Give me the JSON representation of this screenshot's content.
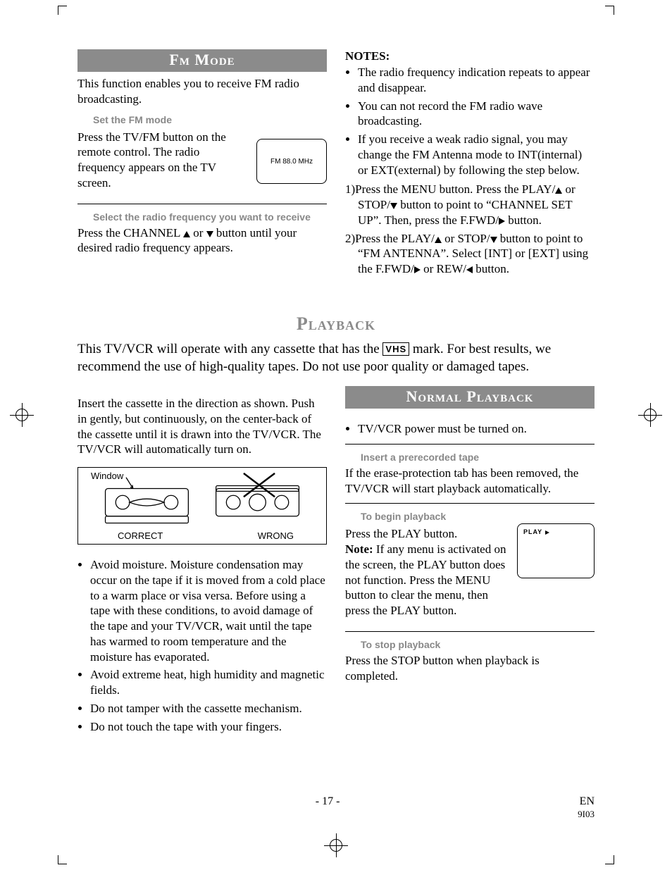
{
  "fm": {
    "heading": "Fm Mode",
    "intro": "This function enables you to receive FM radio broadcasting.",
    "step1_title": "Set the FM mode",
    "step1_text": "Press the TV/FM button on the remote control. The radio frequency appears on the TV screen.",
    "screen_text": "FM 88.0 MHz",
    "step2_title": "Select the radio frequency you want to receive",
    "step2_text_a": "Press the CHANNEL ",
    "step2_text_b": " or ",
    "step2_text_c": " button until your desired radio frequency appears."
  },
  "notes": {
    "heading": "NOTES:",
    "items": [
      "The radio frequency indication repeats to appear and disappear.",
      "You can not record the FM radio wave broadcasting.",
      "If you receive a weak radio signal, you may change the FM Antenna mode to INT(internal) or EXT(external) by following the step below."
    ],
    "n1_a": "1)Press the MENU button. Press the PLAY/",
    "n1_b": " or STOP/",
    "n1_c": " button to point to “CHANNEL SET UP”. Then, press the F.FWD/",
    "n1_d": " button.",
    "n2_a": "2)Press the PLAY/",
    "n2_b": " or STOP/",
    "n2_c": " button to point to “FM ANTENNA”. Select [INT] or [EXT] using the F.FWD/",
    "n2_d": " or REW/",
    "n2_e": " button."
  },
  "playback": {
    "heading": "Playback",
    "intro_a": "This TV/VCR will operate with any cassette that has the ",
    "intro_b": " mark. For best results, we recommend the use of high-quality tapes. Do not use poor quality or damaged tapes.",
    "vhs_mark": "VHS",
    "insert_text": "Insert the cassette in the direction as shown. Push in gently, but continuously, on the center-back of the cassette until it is drawn into the TV/VCR. The TV/VCR will automatically turn on.",
    "fig_window": "Window",
    "fig_correct": "CORRECT",
    "fig_wrong": "WRONG",
    "care_items": [
      "Avoid moisture. Moisture condensation may occur on the tape if it is moved from a cold place to a warm place or visa versa. Before using a tape with these conditions, to avoid damage of the tape and your TV/VCR, wait until the tape has warmed to room temperature and the moisture has evaporated.",
      "Avoid extreme heat, high humidity and magnetic fields.",
      "Do not tamper with the cassette mechanism.",
      "Do not touch the tape with your fingers."
    ]
  },
  "normal": {
    "heading": "Normal Playback",
    "power_item": "TV/VCR power must be turned on.",
    "step1_title": "Insert a prerecorded tape",
    "step1_text": "If the erase-protection tab has been removed, the TV/VCR will start playback automatically.",
    "step2_title": "To begin playback",
    "step2_press": "Press the PLAY button.",
    "step2_note_label": "Note:",
    "step2_note_text": " If any menu is activated on the screen, the PLAY button does not function. Press the MENU button to clear the menu, then press the PLAY button.",
    "play_screen_label": "PLAY",
    "step3_title": "To stop playback",
    "step3_text": "Press the STOP button when playback is completed."
  },
  "footer": {
    "page": "- 17 -",
    "lang": "EN",
    "code": "9I03"
  }
}
